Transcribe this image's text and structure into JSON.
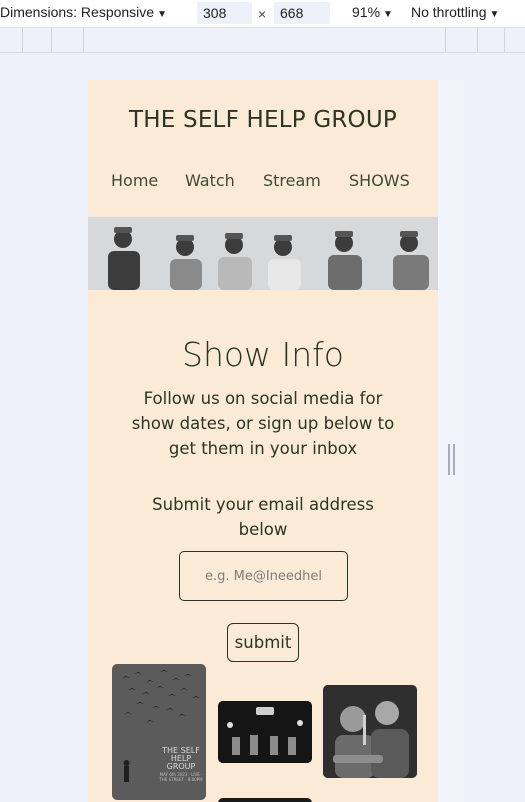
{
  "devtools": {
    "dimensions_label": "Dimensions: Responsive",
    "width": "308",
    "height": "668",
    "times": "×",
    "zoom": "91%",
    "throttle": "No throttling",
    "caret": "▼"
  },
  "site": {
    "title": "THE SELF HELP GROUP",
    "nav": [
      "Home",
      "Watch",
      "Stream",
      "SHOWS"
    ]
  },
  "main": {
    "heading": "Show Info",
    "lead": "Follow us on social media for show dates, or sign up below to get them in your inbox",
    "subheading": "Submit your email address below",
    "email_placeholder": "e.g. Me@Ineedhel",
    "submit_label": "submit",
    "poster_title": "THE SELF HELP GROUP",
    "poster_details": "MAY 6th 2023 · LIVE · THE STREET · 8:00PM"
  },
  "colors": {
    "page_bg": "#fbead6",
    "text": "#2b3525",
    "devtools_bg": "#eef1f9"
  }
}
